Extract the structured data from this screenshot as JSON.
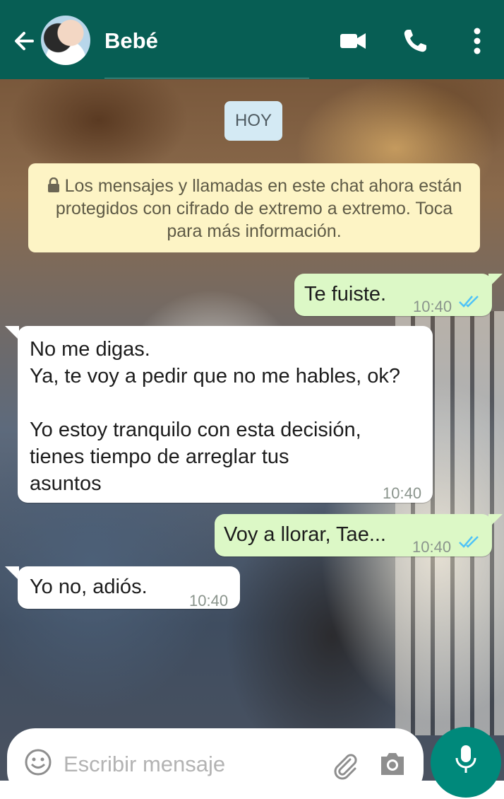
{
  "header": {
    "contact_name": "Bebé",
    "icons": [
      "back-arrow-icon",
      "avatar",
      "video-call-icon",
      "phone-call-icon",
      "more-vert-icon"
    ],
    "color": "#075e54"
  },
  "chat": {
    "date_chip": "HOY",
    "encryption_notice": "Los mensajes y llamadas en este chat ahora están protegidos con cifrado de extremo a extremo. Toca para más información.",
    "messages": [
      {
        "direction": "outgoing",
        "text": "Te fuiste.",
        "time": "10:40",
        "status": "read"
      },
      {
        "direction": "incoming",
        "text": "No me digas.\nYa, te voy a pedir que no me hables, ok?\n\nYo estoy tranquilo con esta decisión,\ntienes tiempo de arreglar tus\nasuntos",
        "time": "10:40"
      },
      {
        "direction": "outgoing",
        "text": "Voy a llorar, Tae...",
        "time": "10:40",
        "status": "read"
      },
      {
        "direction": "incoming",
        "text": "Yo no, adiós.",
        "time": "10:40"
      }
    ]
  },
  "input": {
    "placeholder": "Escribir mensaje",
    "icons": [
      "emoji-icon",
      "paperclip-icon",
      "camera-icon",
      "microphone-icon"
    ]
  },
  "colors": {
    "outgoing_bubble": "#dcf8c6",
    "incoming_bubble": "#ffffff",
    "read_ticks": "#4fc3f7",
    "mic_button": "#00897b"
  }
}
